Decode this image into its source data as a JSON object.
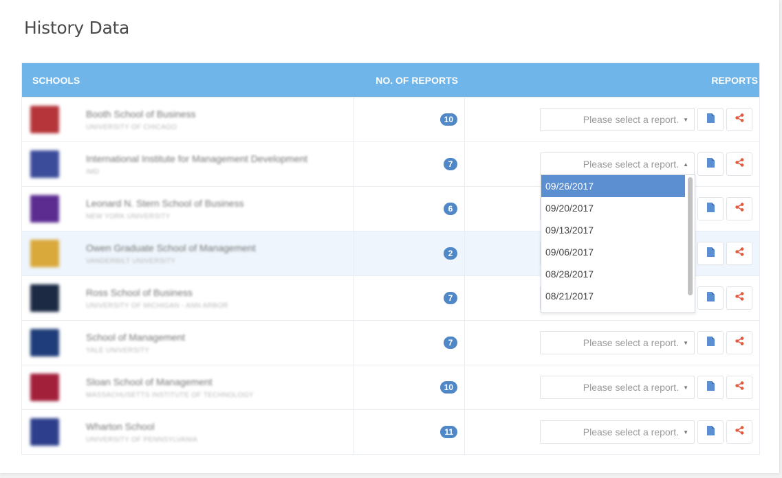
{
  "page": {
    "title": "History Data"
  },
  "table": {
    "headers": {
      "schools": "SCHOOLS",
      "count": "NO. OF REPORTS",
      "reports": "REPORTS"
    },
    "rows": [
      {
        "name": "Booth School of Business",
        "university": "University of Chicago",
        "count": "10",
        "select_placeholder": "Please select a report.",
        "logo_color": "#b5353a"
      },
      {
        "name": "International Institute for Management Development",
        "university": "IMD",
        "count": "7",
        "select_placeholder": "Please select a report.",
        "logo_color": "#3b4c9a"
      },
      {
        "name": "Leonard N. Stern School of Business",
        "university": "New York University",
        "count": "6",
        "select_placeholder": "Please select a report.",
        "logo_color": "#5c2c91"
      },
      {
        "name": "Owen Graduate School of Management",
        "university": "Vanderbilt University",
        "count": "2",
        "select_placeholder": "Please select a report.",
        "logo_color": "#d9a93b"
      },
      {
        "name": "Ross School of Business",
        "university": "University of Michigan - Ann Arbor",
        "count": "7",
        "select_placeholder": "Please select a report.",
        "logo_color": "#1c2a44"
      },
      {
        "name": "School of Management",
        "university": "Yale University",
        "count": "7",
        "select_placeholder": "Please select a report.",
        "logo_color": "#1f3d7a"
      },
      {
        "name": "Sloan School of Management",
        "university": "Massachusetts Institute of Technology",
        "count": "10",
        "select_placeholder": "Please select a report.",
        "logo_color": "#a3203b"
      },
      {
        "name": "Wharton School",
        "university": "University of Pennsylvania",
        "count": "11",
        "select_placeholder": "Please select a report.",
        "logo_color": "#2d3f8c"
      }
    ]
  },
  "dropdown": {
    "open_row": 1,
    "selected_index": 0,
    "options": [
      "09/26/2017",
      "09/20/2017",
      "09/13/2017",
      "09/06/2017",
      "08/28/2017",
      "08/21/2017"
    ]
  },
  "icons": {
    "report": "file-icon",
    "share": "share-icon",
    "caret": "caret-icon"
  },
  "colors": {
    "header_bg": "#6fb5e9",
    "badge": "#4f87c7",
    "file_icon": "#5c8fd2",
    "share_icon": "#e05a3f",
    "selected_option": "#5c8fd2"
  }
}
